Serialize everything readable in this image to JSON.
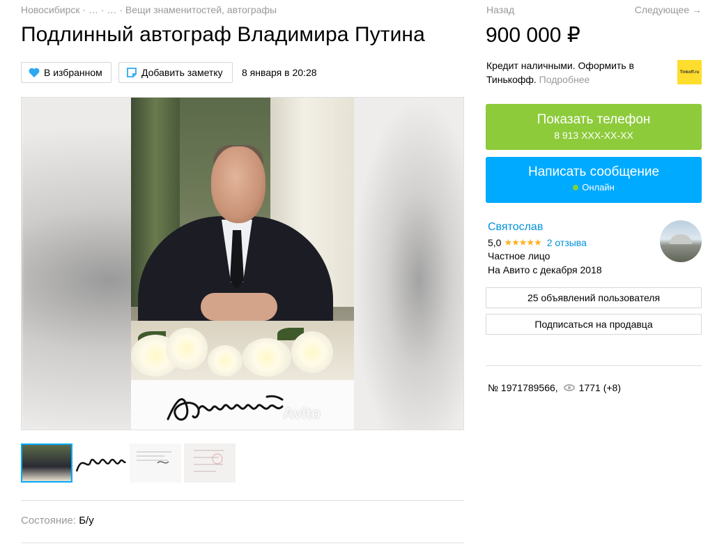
{
  "breadcrumb": {
    "city": "Новосибирск",
    "sep1": " · … · … · ",
    "category": "Вещи знаменитостей, автографы"
  },
  "nav": {
    "prev": "Назад",
    "next": "Следующее →"
  },
  "listing": {
    "title": "Подлинный автограф Владимира Путина",
    "price": "900 000 ₽",
    "date": "8 января в 20:28",
    "condition_label": "Состояние:",
    "condition_value": "Б/у",
    "id_text": "№ 1971789566,",
    "views": "1771 (+8)",
    "watermark": "Avito"
  },
  "actions": {
    "favorite_label": "В избранном",
    "note_label": "Добавить заметку",
    "favorite_icon": "heart-icon",
    "note_icon": "note-icon"
  },
  "credit": {
    "text": "Кредит наличными. Оформить в Тинькофф.",
    "more": "Подробнее",
    "logo_text": "Tinkoff.ru"
  },
  "contact": {
    "phone_label": "Показать телефон",
    "phone_masked": "8 913 XXX-XX-XX",
    "message_label": "Написать сообщение",
    "online_label": "Онлайн",
    "colors": {
      "phone": "#8dcb3b",
      "message": "#00aaff",
      "online": "#7ed03a"
    }
  },
  "seller": {
    "name": "Святослав",
    "rating": "5,0",
    "stars": "★★★★★",
    "reviews": "2 отзыва",
    "type": "Частное лицо",
    "since": "На Авито с декабря 2018",
    "ads_button": "25 объявлений пользователя",
    "subscribe_button": "Подписаться на продавца"
  },
  "gallery": {
    "thumb_count": 4,
    "active_index": 0
  }
}
